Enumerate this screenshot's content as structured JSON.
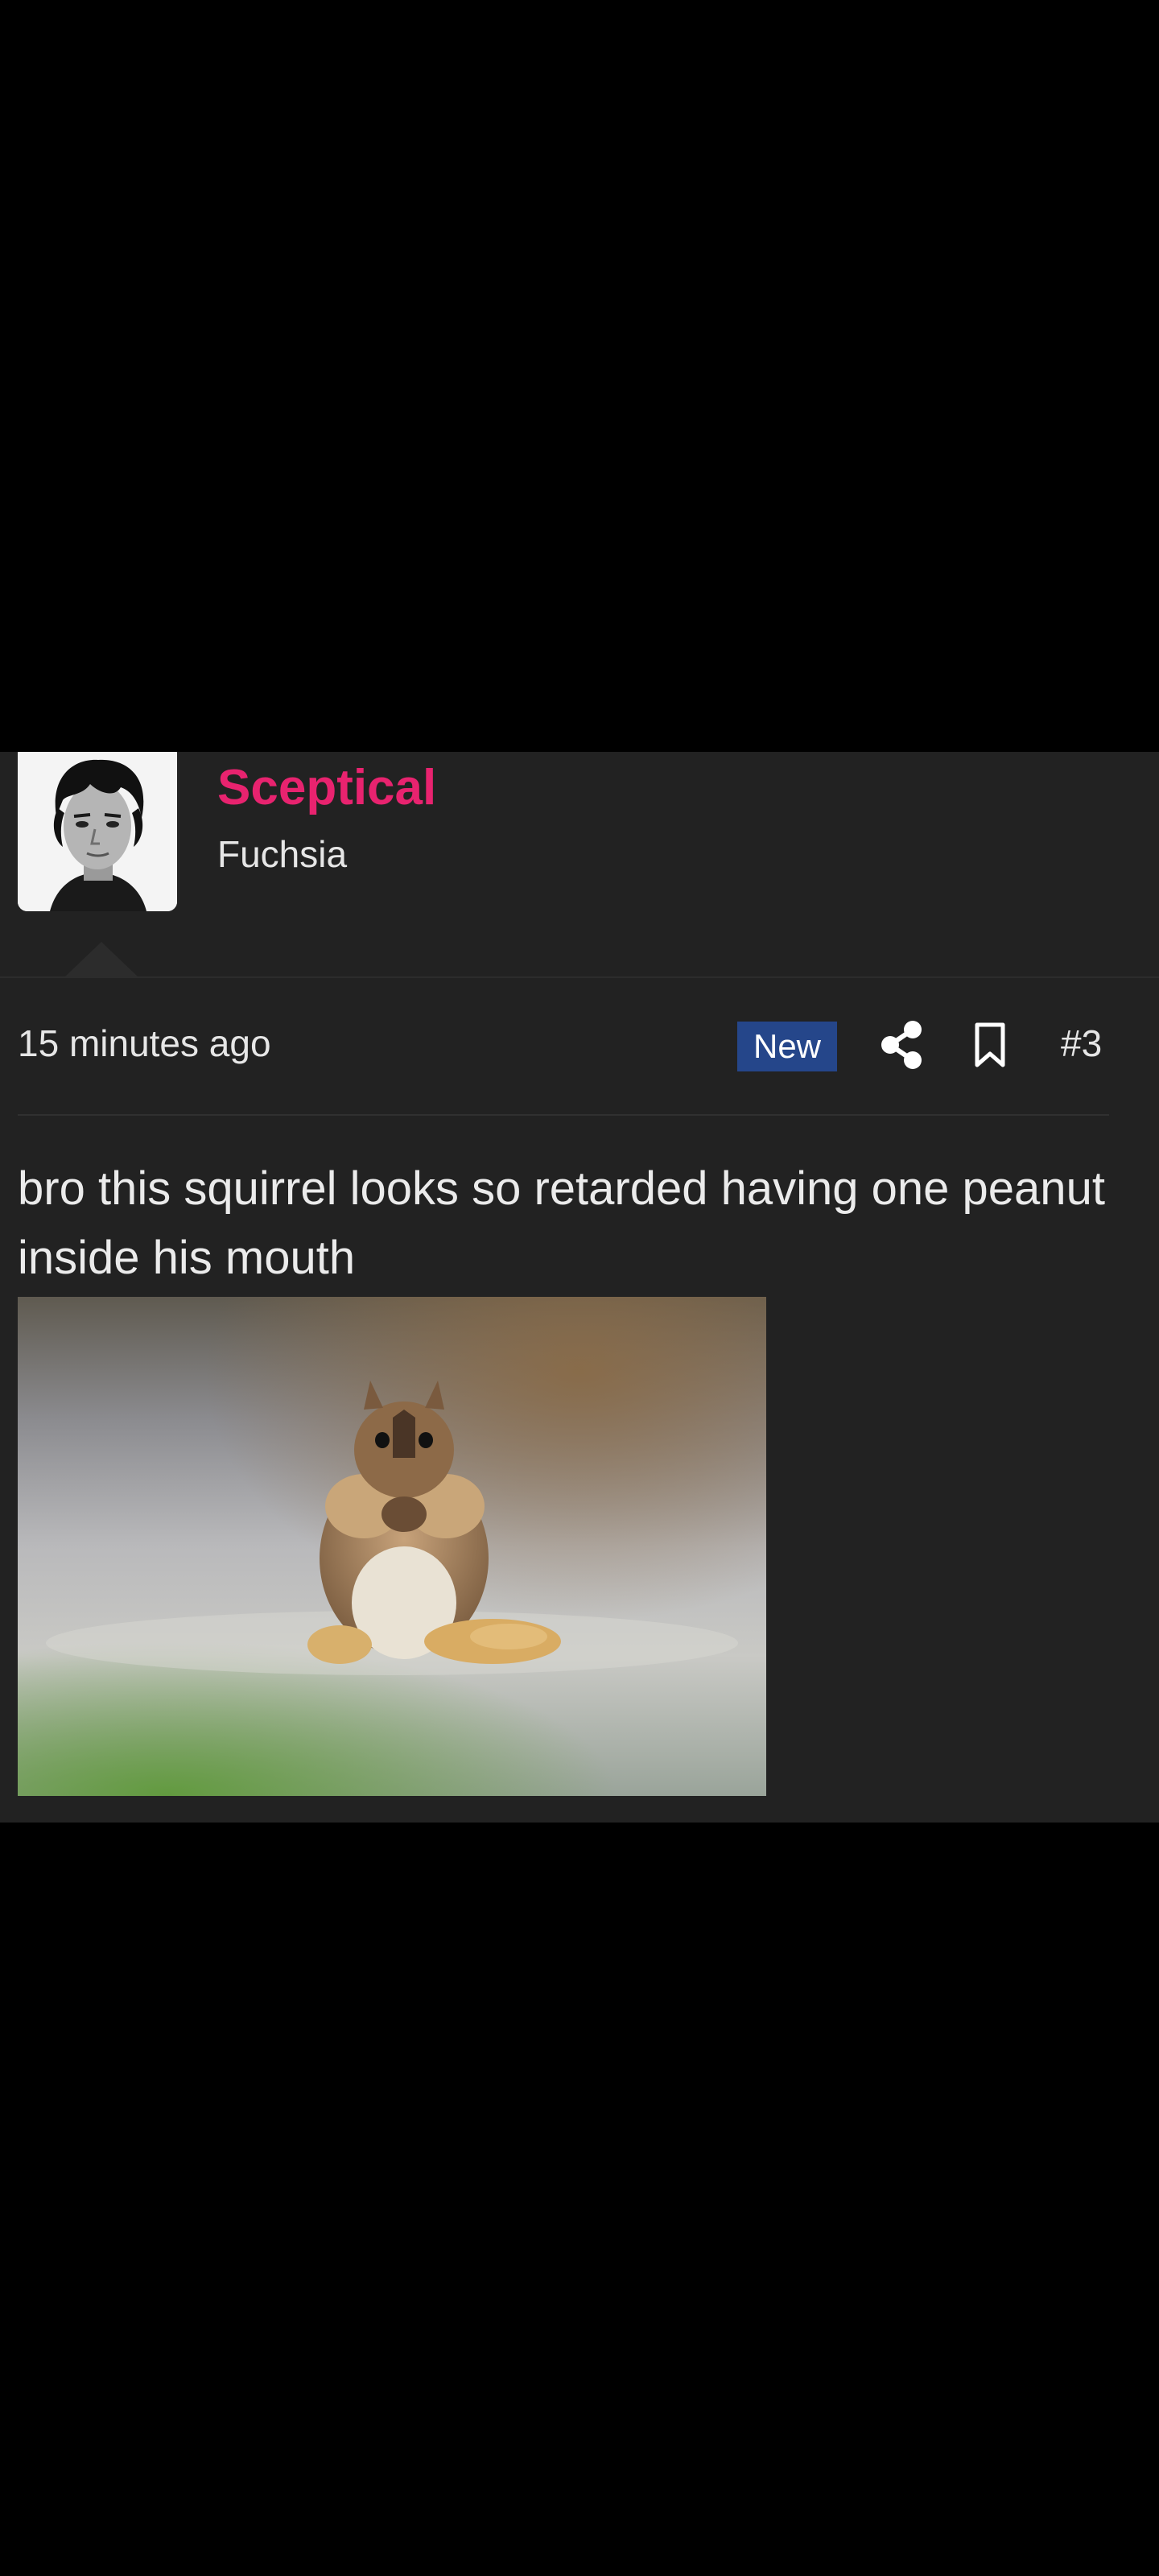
{
  "post": {
    "author": {
      "username": "Sceptical",
      "user_title": "Fuchsia",
      "avatar_icon": "avatar-portrait"
    },
    "meta": {
      "timestamp": "15 minutes ago",
      "badge": "New",
      "share_icon": "share-icon",
      "bookmark_icon": "bookmark-icon",
      "post_number": "#3"
    },
    "body": {
      "text": "bro this squirrel looks so retarded having one peanut inside his mouth",
      "image_icon": "squirrel-photo"
    }
  },
  "colors": {
    "background": "#000000",
    "post_background": "#222222",
    "username": "#e8236f",
    "badge": "#25468a",
    "text": "#e6e6e6"
  }
}
